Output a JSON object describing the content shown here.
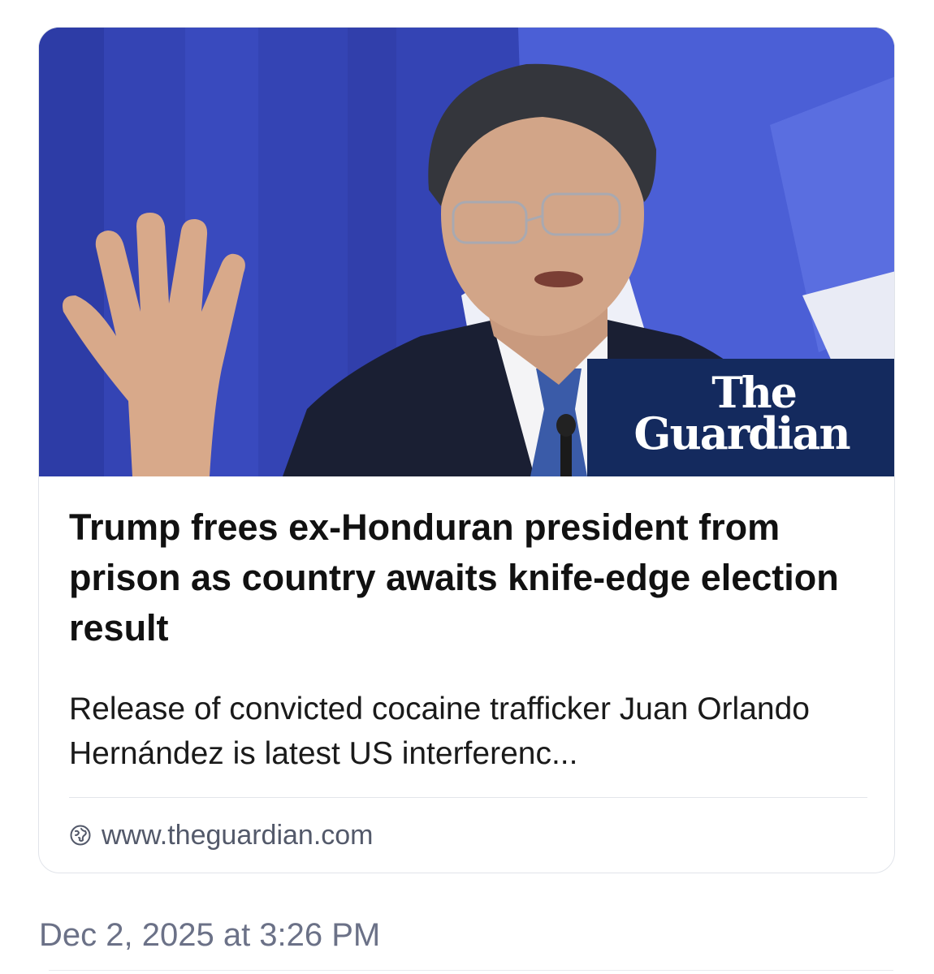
{
  "card": {
    "image_alt": "Juan Orlando Hernández raising his hand",
    "logo": {
      "line1": "The",
      "line2": "Guardian"
    },
    "headline": "Trump frees ex-Honduran president from prison as country awaits knife-edge election result",
    "summary": "Release of convicted cocaine trafficker Juan Orlando Hernández is latest US interferenc...",
    "source_url": "www.theguardian.com",
    "source_icon": "globe-icon"
  },
  "timestamp": "Dec 2, 2025 at 3:26 PM",
  "colors": {
    "hero_bg": "#3747b8",
    "logo_bg": "#142a5e",
    "headline": "#111111",
    "meta": "#6b7187"
  }
}
